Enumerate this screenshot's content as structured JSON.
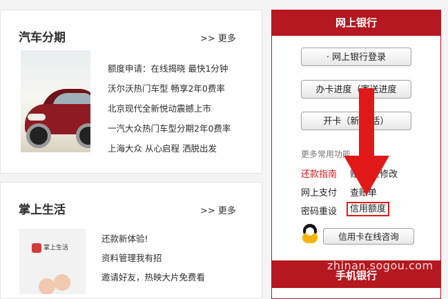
{
  "auto_panel": {
    "title": "汽车分期",
    "more": ">> 更多",
    "lines": [
      "额度申请：在线揭晓 最快1分钟",
      "沃尔沃热门车型 畅享2年0费率",
      "北京现代全新悦动震撼上市",
      "一汽大众热门车型分期2年0费率",
      "上海大众 从心启程 洒脱出发"
    ]
  },
  "life_panel": {
    "title": "掌上生活",
    "more": ">> 更多",
    "logo_text": "掌上生活",
    "lines": [
      "还款新体验!",
      "资料管理我有招",
      "邀请好友，热映大片免费看"
    ]
  },
  "bank_panel": {
    "header": "网上银行",
    "buttons": [
      "· 网上银行登录",
      "办卡进度（寄送进度",
      "开卡（新    激活）"
    ],
    "more_functions_title": "更多常用功能",
    "functions": {
      "repay_guide": "还款指南",
      "account_address": "账    地址修改",
      "online_pay": "网上支付",
      "query_bill": "查账单",
      "password_reset": "密码重设",
      "credit_limit": "信用额度"
    },
    "online_service": "信用卡在线咨询",
    "mobile_bank": "手机银行"
  },
  "watermark": "zhinan.sogou.com",
  "colors": {
    "bank_red": "#b51820",
    "arrow_red": "#e01818",
    "link_red": "#d01818"
  }
}
